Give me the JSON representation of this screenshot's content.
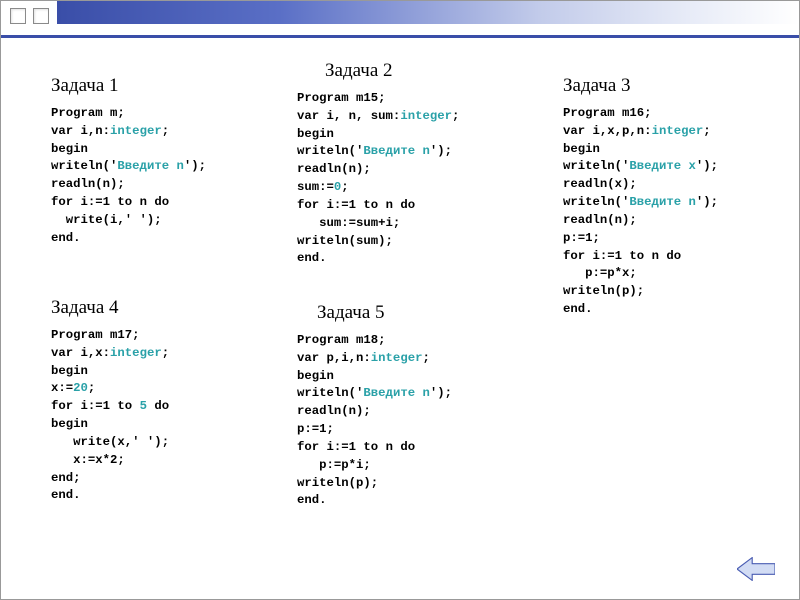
{
  "tasks": {
    "t1": {
      "title": "Задача 1",
      "code_html": "<span>Program</span> m;\n<span>var</span> i,n:<span class='kw-type'>integer</span>;\n<span>begin</span>\nwriteln('<span class='kw-str'>Введите n</span>');\nreadln(n);\n<span>for</span> i:=1 <span>to</span> n <span>do</span>\n  write(i,' ');\n<span>end</span>."
    },
    "t2": {
      "title": "Задача 2",
      "code_html": "<span>Program</span> m15;\n<span>var</span> i, n, sum:<span class='kw-type'>integer</span>;\n<span>begin</span>\nwriteln('<span class='kw-str'>Введите n</span>');\nreadln(n);\nsum:=<span class='kw-num'>0</span>;\n<span>for</span> i:=1 <span>to</span> n <span>do</span>\n   sum:=sum+i;\nwriteln(sum);\n<span>end</span>."
    },
    "t3": {
      "title": "Задача 3",
      "code_html": "<span>Program</span> m16;\n<span>var</span> i,x,p,n:<span class='kw-type'>integer</span>;\n<span>begin</span>\nwriteln('<span class='kw-str'>Введите x</span>');\nreadln(x);\nwriteln('<span class='kw-str'>Введите n</span>');\nreadln(n);\np:=1;\n<span>for</span> i:=1 <span>to</span> n <span>do</span>\n   p:=p*x;\nwriteln(p);\n<span>end</span>."
    },
    "t4": {
      "title": "Задача 4",
      "code_html": "<span>Program</span> m17;\n<span>var</span> i,x:<span class='kw-type'>integer</span>;\n<span>begin</span>\nx:=<span class='kw-num'>20</span>;\n<span>for</span> i:=1 <span>to</span> <span class='kw-num'>5</span> <span>do</span>\n<span>begin</span>\n   write(x,' ');\n   x:=x*2;\n<span>end</span>;\n<span>end</span>."
    },
    "t5": {
      "title": "Задача 5",
      "code_html": "<span>Program</span> m18;\n<span>var</span> p,i,n:<span class='kw-type'>integer</span>;\n<span>begin</span>\nwriteln('<span class='kw-str'>Введите n</span>');\nreadln(n);\np:=1;\n<span>for</span> i:=1 <span>to</span> n <span>do</span>\n   p:=p*i;\nwriteln(p);\n<span>end</span>."
    }
  },
  "nav": {
    "back_label": "back"
  }
}
